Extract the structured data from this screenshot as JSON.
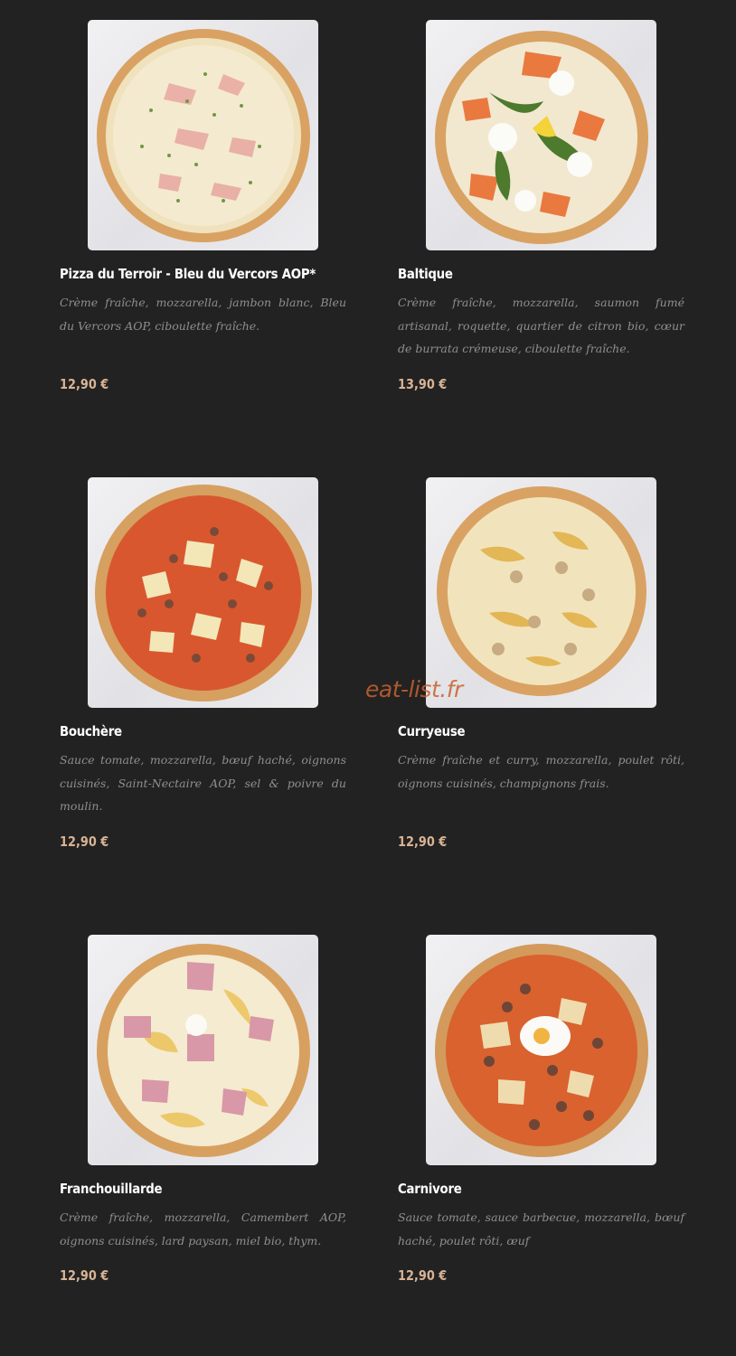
{
  "menu": {
    "items": [
      {
        "name": "Pizza du Terroir - Bleu du Vercors AOP*",
        "description": "Crème fraîche, mozzarella, jambon blanc, Bleu du Vercors AOP, ciboulette fraîche.",
        "price": "12,90 €"
      },
      {
        "name": "Baltique",
        "description": "Crème fraîche, mozzarella, saumon fumé artisanal, roquette, quartier de citron bio, cœur de burrata crémeuse, ciboulette fraîche.",
        "price": "13,90 €"
      },
      {
        "name": "Bouchère",
        "description": "Sauce tomate, mozzarella, bœuf haché, oignons cuisinés, Saint-Nectaire AOP, sel & poivre du moulin.",
        "price": "12,90 €"
      },
      {
        "name": "Curryeuse",
        "description": "Crème fraîche et curry, mozzarella, poulet rôti, oignons cuisinés, champignons frais.",
        "price": "12,90 €"
      },
      {
        "name": "Franchouillarde",
        "description": "Crème fraîche, mozzarella, Camembert AOP, oignons cuisinés, lard paysan, miel bio, thym.",
        "price": "12,90 €"
      },
      {
        "name": "Carnivore",
        "description": "Sauce tomate, sauce barbecue, mozzarella, bœuf haché, poulet rôti, œuf",
        "price": "12,90 €"
      }
    ]
  },
  "watermark": "eat-list.fr",
  "colors": {
    "background": "#222222",
    "title": "#ffffff",
    "description": "#8f8f8f",
    "price": "#d9b394",
    "watermark": "#c8612f"
  }
}
